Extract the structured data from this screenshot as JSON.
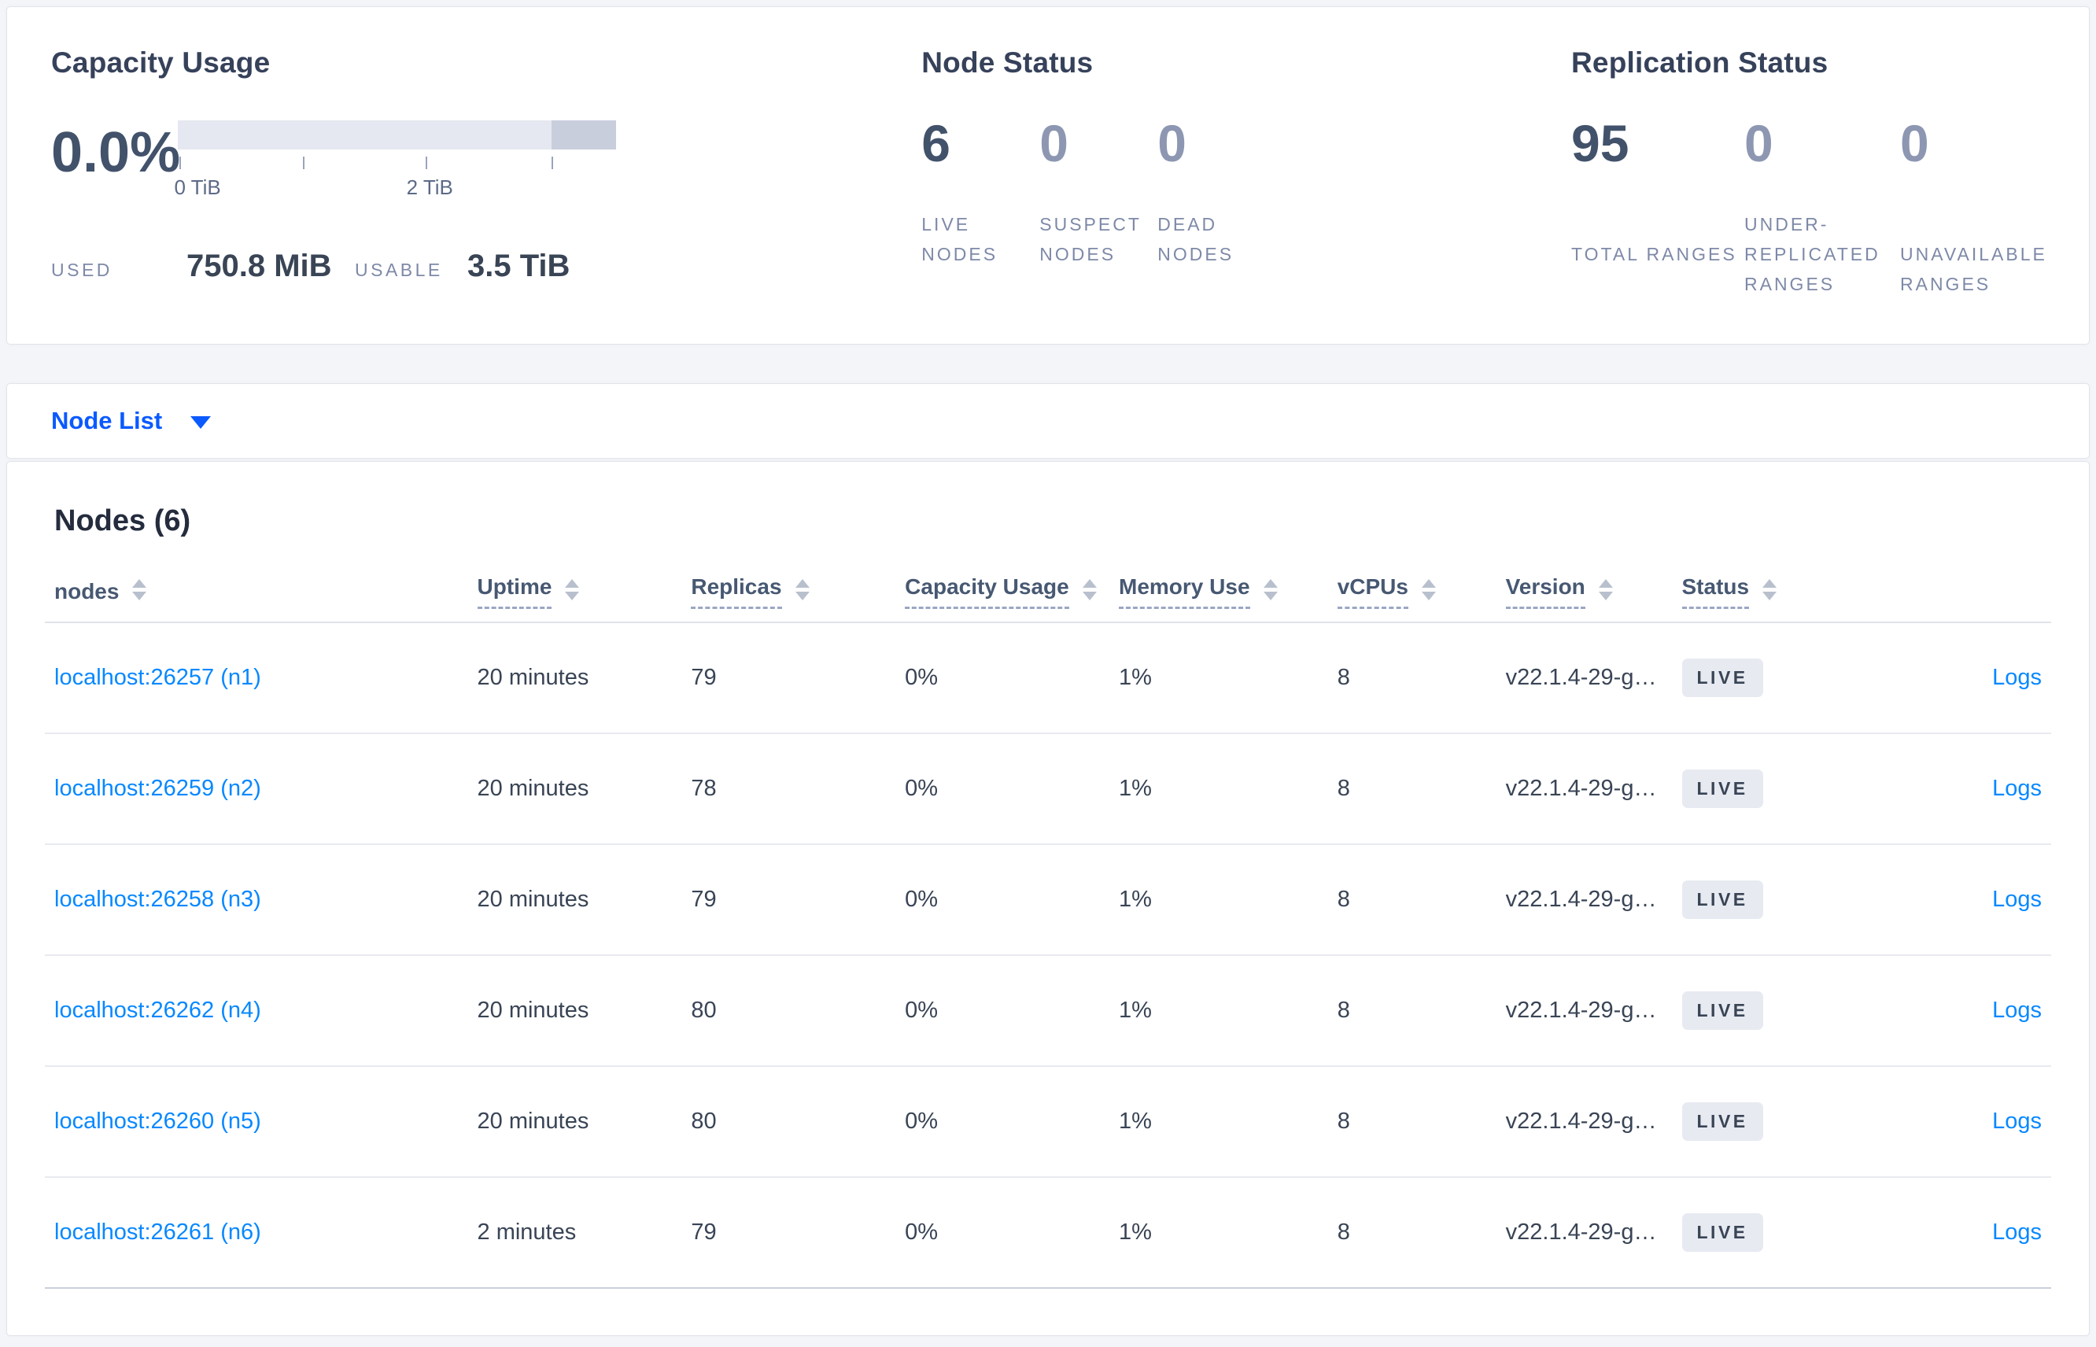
{
  "colors": {
    "page_bg": "#f4f5f9",
    "link_blue": "#0788ff",
    "dropdown_blue": "#0b5aff",
    "bar_light": "#e5e7f1",
    "bar_dark": "#c9cedd",
    "badge_bg": "#e7eaf1",
    "number_dark": "#42526b",
    "number_muted": "#8d97b2"
  },
  "capacity": {
    "title": "Capacity Usage",
    "percent": "0.0%",
    "axis_tick_labels": [
      "0 TiB",
      "2 TiB"
    ],
    "used_label": "USED",
    "used_value": "750.8 MiB",
    "usable_label": "USABLE",
    "usable_value": "3.5 TiB"
  },
  "node_status": {
    "title": "Node Status",
    "stats": [
      {
        "value": "6",
        "label": "LIVE NODES"
      },
      {
        "value": "0",
        "label": "SUSPECT NODES"
      },
      {
        "value": "0",
        "label": "DEAD NODES"
      }
    ]
  },
  "replication_status": {
    "title": "Replication Status",
    "stats": [
      {
        "value": "95",
        "label": "TOTAL RANGES"
      },
      {
        "value": "0",
        "label": "UNDER-REPLICATED RANGES"
      },
      {
        "value": "0",
        "label": "UNAVAILABLE RANGES"
      }
    ]
  },
  "node_list": {
    "label": "Node List"
  },
  "nodes_table": {
    "title": "Nodes (6)",
    "columns": [
      {
        "label": "nodes"
      },
      {
        "label": "Uptime"
      },
      {
        "label": "Replicas"
      },
      {
        "label": "Capacity Usage"
      },
      {
        "label": "Memory Use"
      },
      {
        "label": "vCPUs"
      },
      {
        "label": "Version"
      },
      {
        "label": "Status"
      }
    ],
    "rows": [
      {
        "node": "localhost:26257 (n1)",
        "uptime": "20 minutes",
        "replicas": "79",
        "capacity": "0%",
        "memory": "1%",
        "vcpus": "8",
        "version": "v22.1.4-29-g…",
        "status": "LIVE",
        "logs": "Logs"
      },
      {
        "node": "localhost:26259 (n2)",
        "uptime": "20 minutes",
        "replicas": "78",
        "capacity": "0%",
        "memory": "1%",
        "vcpus": "8",
        "version": "v22.1.4-29-g…",
        "status": "LIVE",
        "logs": "Logs"
      },
      {
        "node": "localhost:26258 (n3)",
        "uptime": "20 minutes",
        "replicas": "79",
        "capacity": "0%",
        "memory": "1%",
        "vcpus": "8",
        "version": "v22.1.4-29-g…",
        "status": "LIVE",
        "logs": "Logs"
      },
      {
        "node": "localhost:26262 (n4)",
        "uptime": "20 minutes",
        "replicas": "80",
        "capacity": "0%",
        "memory": "1%",
        "vcpus": "8",
        "version": "v22.1.4-29-g…",
        "status": "LIVE",
        "logs": "Logs"
      },
      {
        "node": "localhost:26260 (n5)",
        "uptime": "20 minutes",
        "replicas": "80",
        "capacity": "0%",
        "memory": "1%",
        "vcpus": "8",
        "version": "v22.1.4-29-g…",
        "status": "LIVE",
        "logs": "Logs"
      },
      {
        "node": "localhost:26261 (n6)",
        "uptime": "2 minutes",
        "replicas": "79",
        "capacity": "0%",
        "memory": "1%",
        "vcpus": "8",
        "version": "v22.1.4-29-g…",
        "status": "LIVE",
        "logs": "Logs"
      }
    ]
  }
}
